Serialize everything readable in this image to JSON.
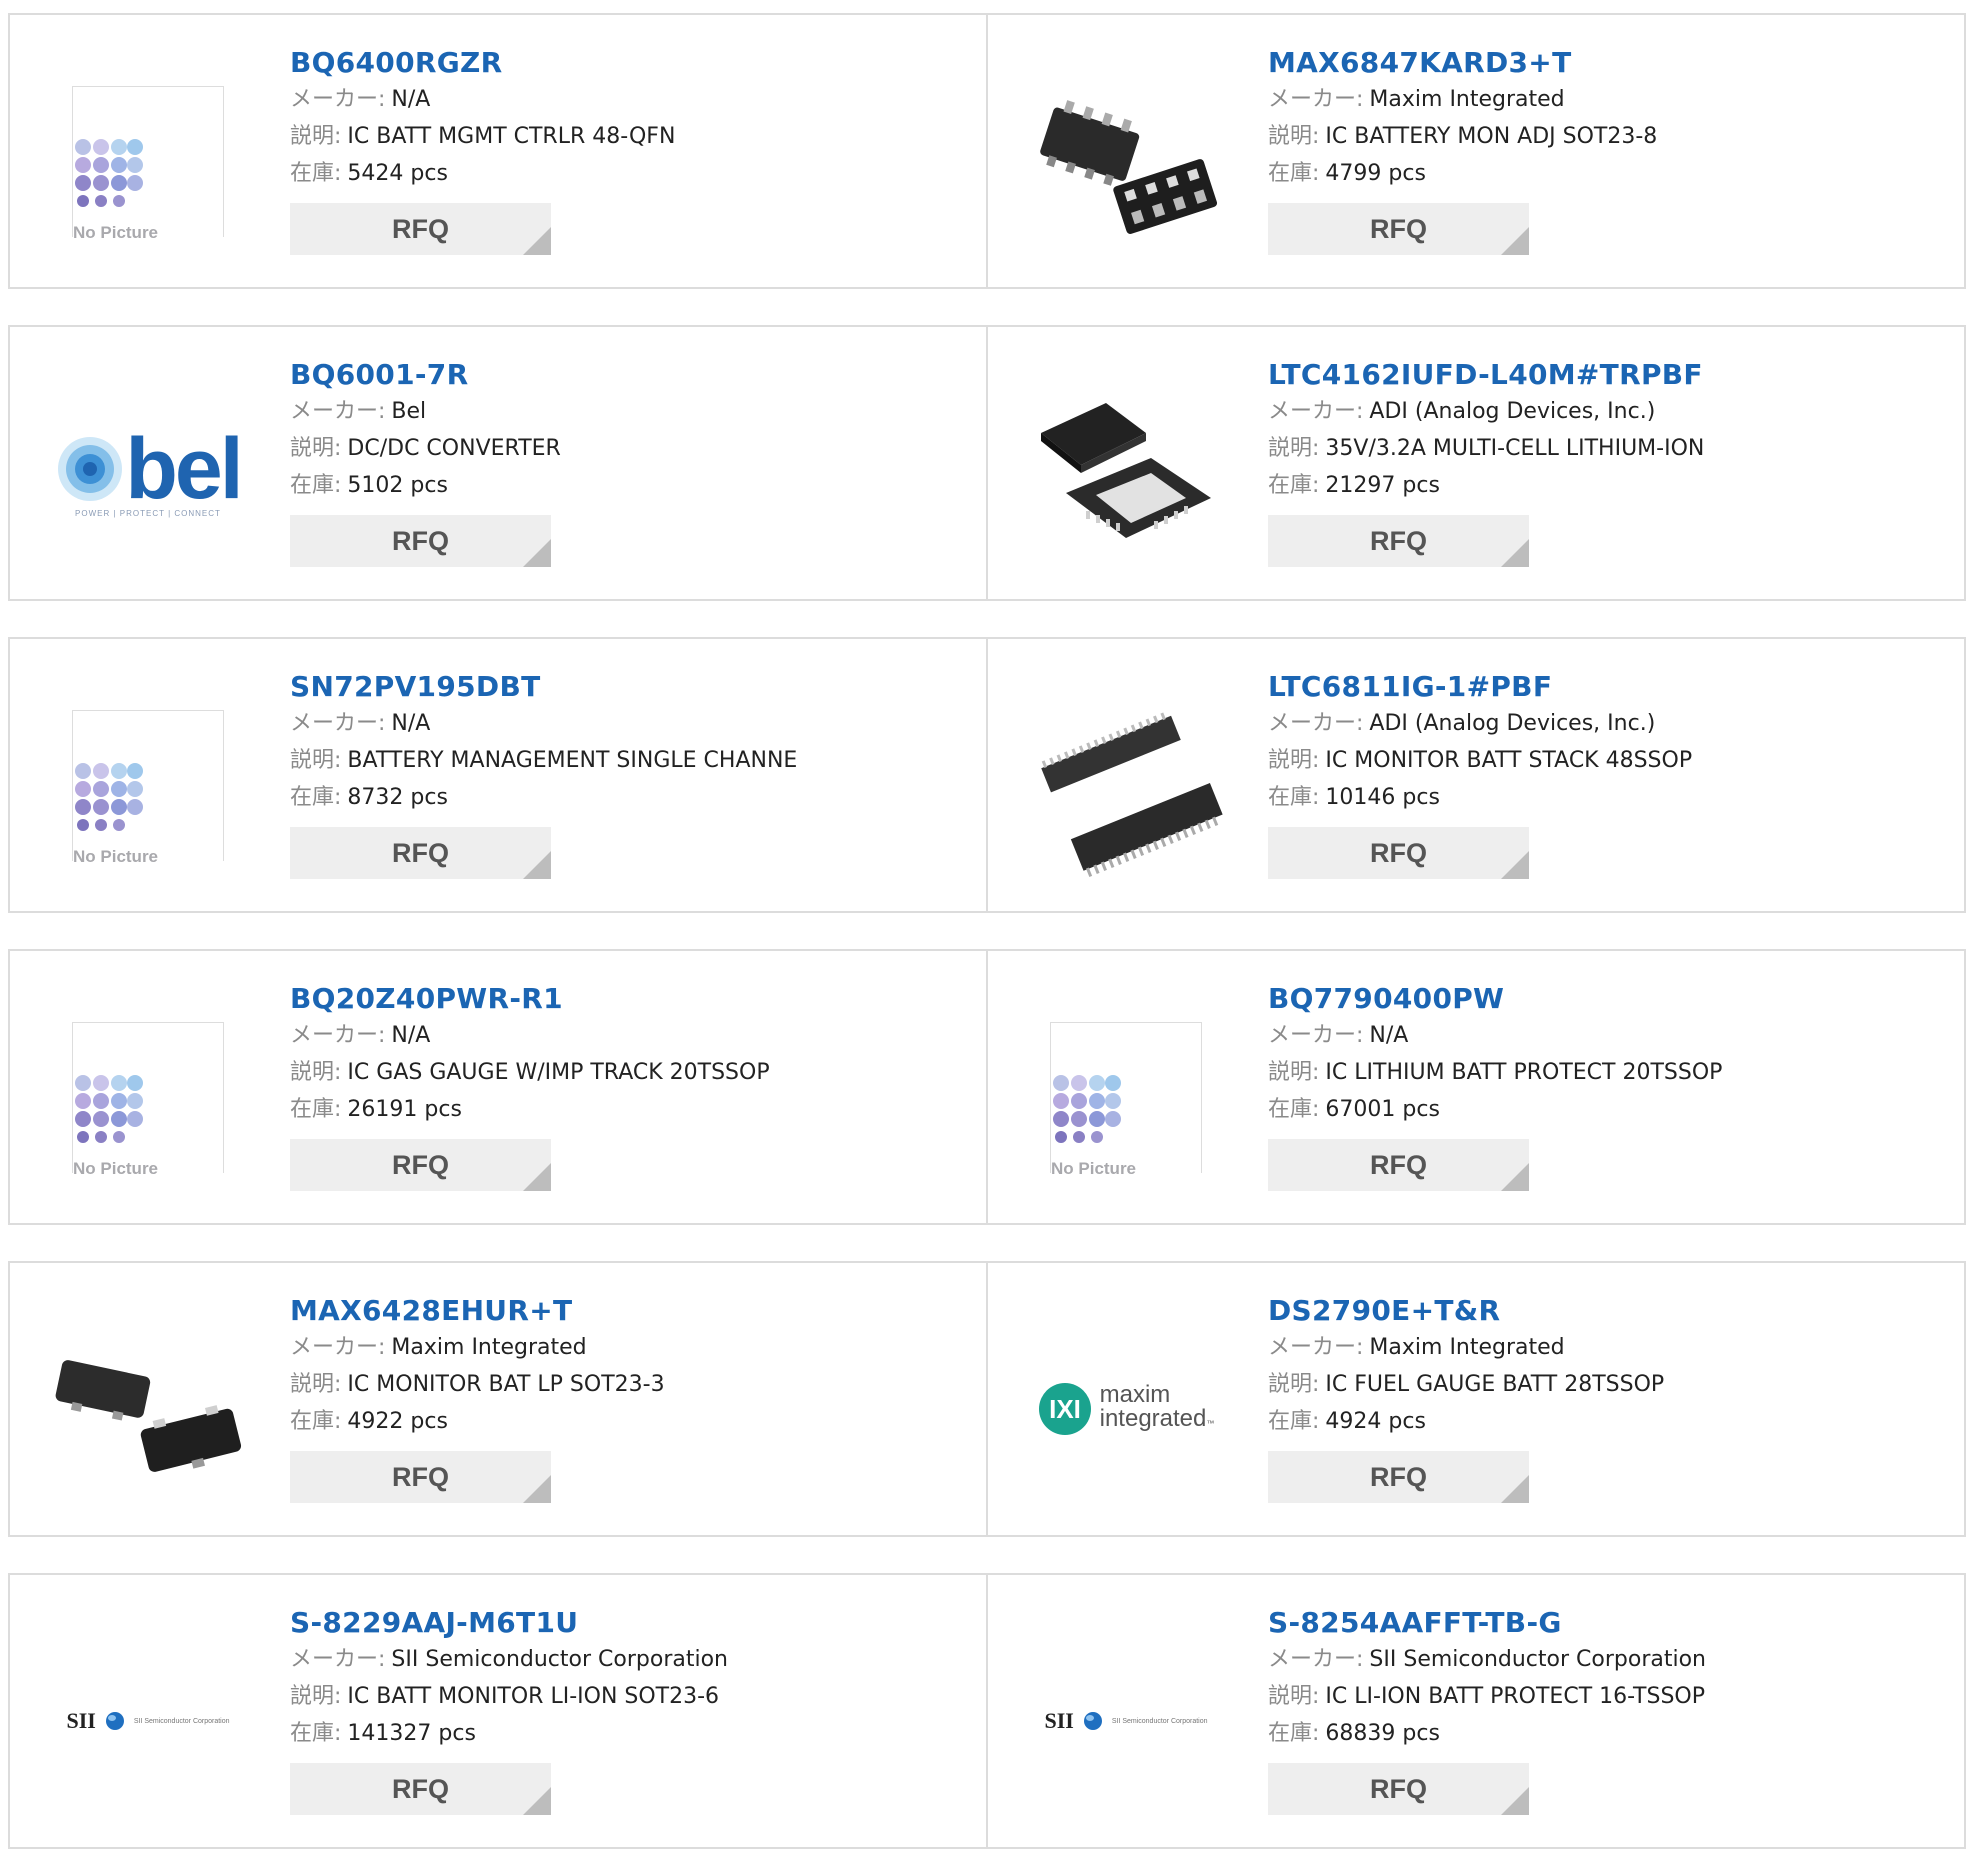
{
  "common": {
    "maker_label": "メーカー:",
    "desc_label": "説明:",
    "stock_label": "在庫:",
    "rfq_label": "RFQ",
    "no_picture_text": "No Picture"
  },
  "products": [
    {
      "part": "BQ6400RGZR",
      "maker": "N/A",
      "desc": "IC BATT MGMT CTRLR 48-QFN",
      "stock": "5424 pcs",
      "image": "no-picture"
    },
    {
      "part": "MAX6847KARD3+T",
      "maker": "Maxim Integrated",
      "desc": "IC BATTERY MON ADJ SOT23-8",
      "stock": "4799 pcs",
      "image": "sot23-8-chip"
    },
    {
      "part": "BQ6001-7R",
      "maker": "Bel",
      "desc": "DC/DC CONVERTER",
      "stock": "5102 pcs",
      "image": "bel-logo",
      "brand_text": "bel",
      "brand_tagline": "POWER | PROTECT | CONNECT"
    },
    {
      "part": "LTC4162IUFD-L40M#TRPBF",
      "maker": "ADI (Analog Devices, Inc.)",
      "desc": "35V/3.2A MULTI-CELL LITHIUM-ION",
      "stock": "21297 pcs",
      "image": "qfn-chip"
    },
    {
      "part": "SN72PV195DBT",
      "maker": "N/A",
      "desc": "BATTERY MANAGEMENT SINGLE CHANNE",
      "stock": "8732 pcs",
      "image": "no-picture"
    },
    {
      "part": "LTC6811IG-1#PBF",
      "maker": "ADI (Analog Devices, Inc.)",
      "desc": "IC MONITOR BATT STACK 48SSOP",
      "stock": "10146 pcs",
      "image": "ssop-chip"
    },
    {
      "part": "BQ20Z40PWR-R1",
      "maker": "N/A",
      "desc": "IC GAS GAUGE W/IMP TRACK 20TSSOP",
      "stock": "26191 pcs",
      "image": "no-picture"
    },
    {
      "part": "BQ7790400PW",
      "maker": "N/A",
      "desc": "IC LITHIUM BATT PROTECT 20TSSOP",
      "stock": "67001 pcs",
      "image": "no-picture"
    },
    {
      "part": "MAX6428EHUR+T",
      "maker": "Maxim Integrated",
      "desc": "IC MONITOR BAT LP SOT23-3",
      "stock": "4922 pcs",
      "image": "sot23-3-chip"
    },
    {
      "part": "DS2790E+T&R",
      "maker": "Maxim Integrated",
      "desc": "IC FUEL GAUGE BATT 28TSSOP",
      "stock": "4924 pcs",
      "image": "maxim-logo",
      "brand_text": "maxim",
      "brand_text2": "integrated",
      "brand_tm": "™"
    },
    {
      "part": "S-8229AAJ-M6T1U",
      "maker": "SII Semiconductor Corporation",
      "desc": "IC BATT MONITOR LI-ION SOT23-6",
      "stock": "141327 pcs",
      "image": "sii-logo",
      "brand_text": "SII",
      "brand_sub": "SII Semiconductor Corporation"
    },
    {
      "part": "S-8254AAFFT-TB-G",
      "maker": "SII Semiconductor Corporation",
      "desc": "IC LI-ION BATT PROTECT 16-TSSOP",
      "stock": "68839 pcs",
      "image": "sii-logo",
      "brand_text": "SII",
      "brand_sub": "SII Semiconductor Corporation"
    }
  ],
  "colors": {
    "part_link": "#1b65b3",
    "label": "#8a8a8a",
    "border": "#dcdcdc",
    "rfq_bg": "#eeeeee",
    "bel_blue": "#1f64b0",
    "maxim_teal": "#1aa38e"
  }
}
